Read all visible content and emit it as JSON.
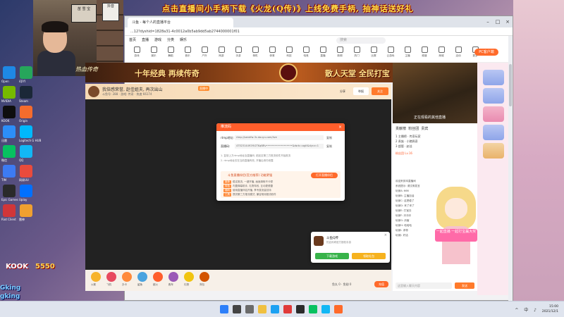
{
  "overlay": {
    "banner": "点击直播间小手柄下载《火龙(Q传)》上线免费手柄, 抽神话送好礼"
  },
  "desktop": {
    "icons": [
      {
        "label": "Open"
      },
      {
        "label": "iQIYI"
      },
      {
        "label": "NVIDIA"
      },
      {
        "label": "Steam"
      },
      {
        "label": "KOOK"
      },
      {
        "label": "Origin"
      },
      {
        "label": "迅雷"
      },
      {
        "label": "Logitech G HUB"
      },
      {
        "label": "微信"
      },
      {
        "label": "QQ"
      },
      {
        "label": "TIM"
      },
      {
        "label": "网易UU"
      },
      {
        "label": "Epic Games"
      },
      {
        "label": "Uplay"
      },
      {
        "label": "Riot Client"
      },
      {
        "label": "雷神"
      }
    ],
    "kook_text": "KOOK",
    "kook_num": "5550",
    "gking_1": "Gking",
    "gking_2": "gking"
  },
  "webcam": {
    "sign": "苗 雪 宝",
    "sign2": "抖音"
  },
  "browser": {
    "tab_title": "斗鱼 - 每个人的直播平台",
    "url": "...12?dyshid=1828a31-4c0012a0b5ab9dd5ab2744000001f01",
    "nav": [
      "首页",
      "直播",
      "游戏",
      "分类",
      "娱乐"
    ],
    "search_placeholder": "搜索",
    "categories": [
      "游戏",
      "娱乐",
      "舞蹈",
      "音乐",
      "户外",
      "网游",
      "手游",
      "单机",
      "体育",
      "科技",
      "电竞",
      "直播",
      "新闻",
      "热门",
      "比赛",
      "云游戏",
      "主播",
      "频道",
      "商城",
      "活动",
      "更多"
    ],
    "pc_client": "PC客户端"
  },
  "ad": {
    "left": "十年经典 再续传奇",
    "right": "散人天堂 全民打宝",
    "logo": "热血传奇"
  },
  "stream": {
    "title": "我倍感荣誉, 赵佳姐夫, 再次出山",
    "tag": "直播中",
    "meta": "斗鱼号: 288 · 游戏: 传奇 · 热度 66174",
    "follow": "关注",
    "share": "分享",
    "report": "举报"
  },
  "gifts": [
    {
      "label": "火箭"
    },
    {
      "label": "飞机"
    },
    {
      "label": "办卡"
    },
    {
      "label": "鲨鱼"
    },
    {
      "label": "超火"
    },
    {
      "label": "跑车"
    },
    {
      "label": "礼物"
    },
    {
      "label": "背包"
    }
  ],
  "bottom": {
    "stats": "鱼丸 0 · 鱼翅 0",
    "pay": "充值"
  },
  "preview": {
    "label": "正在观看的其他直播"
  },
  "side": {
    "tabs": [
      "贡献榜",
      "粉丝团",
      "贵宾"
    ],
    "rows": [
      "1 主播榜 · 传奇玩家",
      "2 贵族 · 小猪佩奇",
      "3 超管 · 赵佳"
    ],
    "fans": "粉丝团 Lv.16",
    "chat": [
      "欢迎来到本直播间",
      "系统提示: 请文明发言",
      "玩家A: 666",
      "玩家B: 主播加油",
      "玩家C: 这把稳了",
      "玩家D: 来了来了",
      "玩家E: 打宝去",
      "玩家F: 冲冲冲",
      "玩家G: 厉害",
      "玩家H: 哈哈哈",
      "玩家I: 求带",
      "玩家J: 好活"
    ],
    "anime_banner": "一起直播\n一起打宝赢大奖",
    "chat_placeholder": "这里输入聊天内容",
    "send": "发送"
  },
  "modal": {
    "title": "推流码",
    "close": "×",
    "rtmp_label": "rtmp地址:",
    "rtmp_value": "rtmp://sendfw-3c.douyu.com/live",
    "code_label": "直播码:",
    "code_value": "4752314491Yk2TKqNRv••••••••••••••••••&dsrtc=ogit&dycv=1",
    "copy1": "复制",
    "copy2": "复制",
    "tip1": "1. 复制上方rtmp地址及直播码, 粘贴至第三方推流软件开始推流",
    "tip2": "2. rtmp地址仅在当前直播有效, 开播后请勿泄露",
    "promo_title": "斗鱼直播伴侣(官方推荐) 功能更强",
    "promo_btn": "打开直播伴侣",
    "promo_items": [
      {
        "tag": "推荐",
        "text": "稳定推流, 一键开播, 画面清晰不卡顿"
      },
      {
        "tag": "特色",
        "text": "内置弹幕助手, 礼物特效, 互动更便捷"
      },
      {
        "tag": "福利",
        "text": "使用直播伴侣开播, 享专属流量扶持"
      },
      {
        "tag": "工具",
        "text": "提供第三方推流模式, 兼容常用推流软件"
      }
    ]
  },
  "popup": {
    "title": "斗鱼Q传",
    "desc": "热血传奇官方授权手游",
    "close": "×",
    "btn1": "下载游戏",
    "btn2": "领取礼包"
  },
  "taskbar": {
    "time": "15:00",
    "date": "2021/12/1",
    "tray": "^ 中 ♪"
  }
}
